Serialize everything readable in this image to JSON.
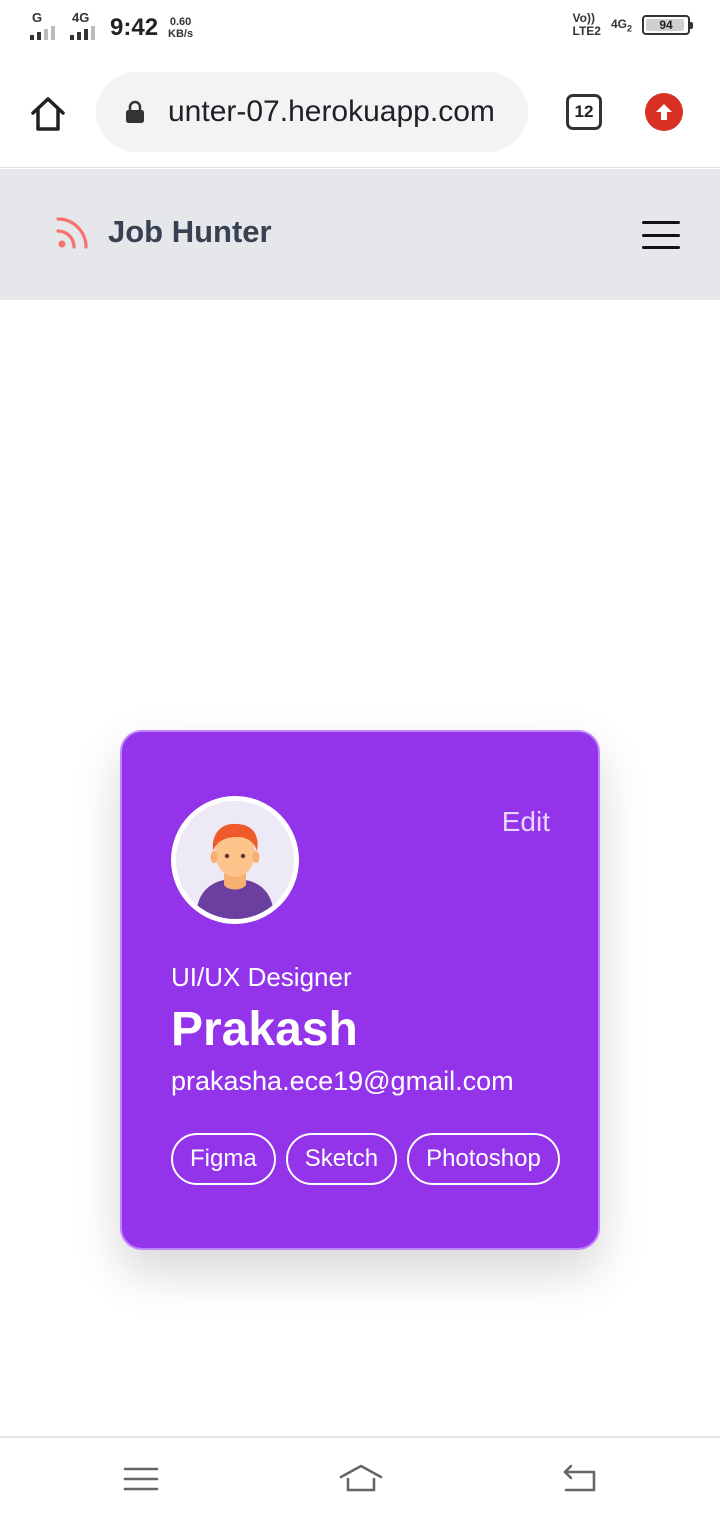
{
  "status_bar": {
    "sim1_label": "G",
    "sim2_label": "4G",
    "time": "9:42",
    "speed_value": "0.60",
    "speed_unit": "KB/s",
    "volte_line1": "Vo))",
    "volte_line2": "LTE2",
    "network": "4G",
    "network_sub": "2",
    "battery": "94"
  },
  "browser": {
    "url": "unter-07.herokuapp.com",
    "tab_count": "12",
    "home_icon": "home-icon",
    "lock_icon": "lock-icon",
    "upgrade_icon": "arrow-up-icon",
    "upgrade_color": "#d93025"
  },
  "navbar": {
    "brand_name": "Job Hunter",
    "brand_icon": "rss-icon",
    "brand_icon_color": "#f87171",
    "menu_icon": "hamburger-menu-icon",
    "background": "#e5e7eb"
  },
  "profile_card": {
    "edit_label": "Edit",
    "role": "UI/UX Designer",
    "name": "Prakash",
    "email": "prakasha.ece19@gmail.com",
    "skills": [
      "Figma",
      "Sketch",
      "Photoshop"
    ],
    "card_color": "#9333ea",
    "avatar_icon": "user-avatar-icon"
  },
  "system_nav": {
    "menu_icon": "recent-apps-icon",
    "home_icon": "home-icon",
    "back_icon": "back-icon"
  }
}
